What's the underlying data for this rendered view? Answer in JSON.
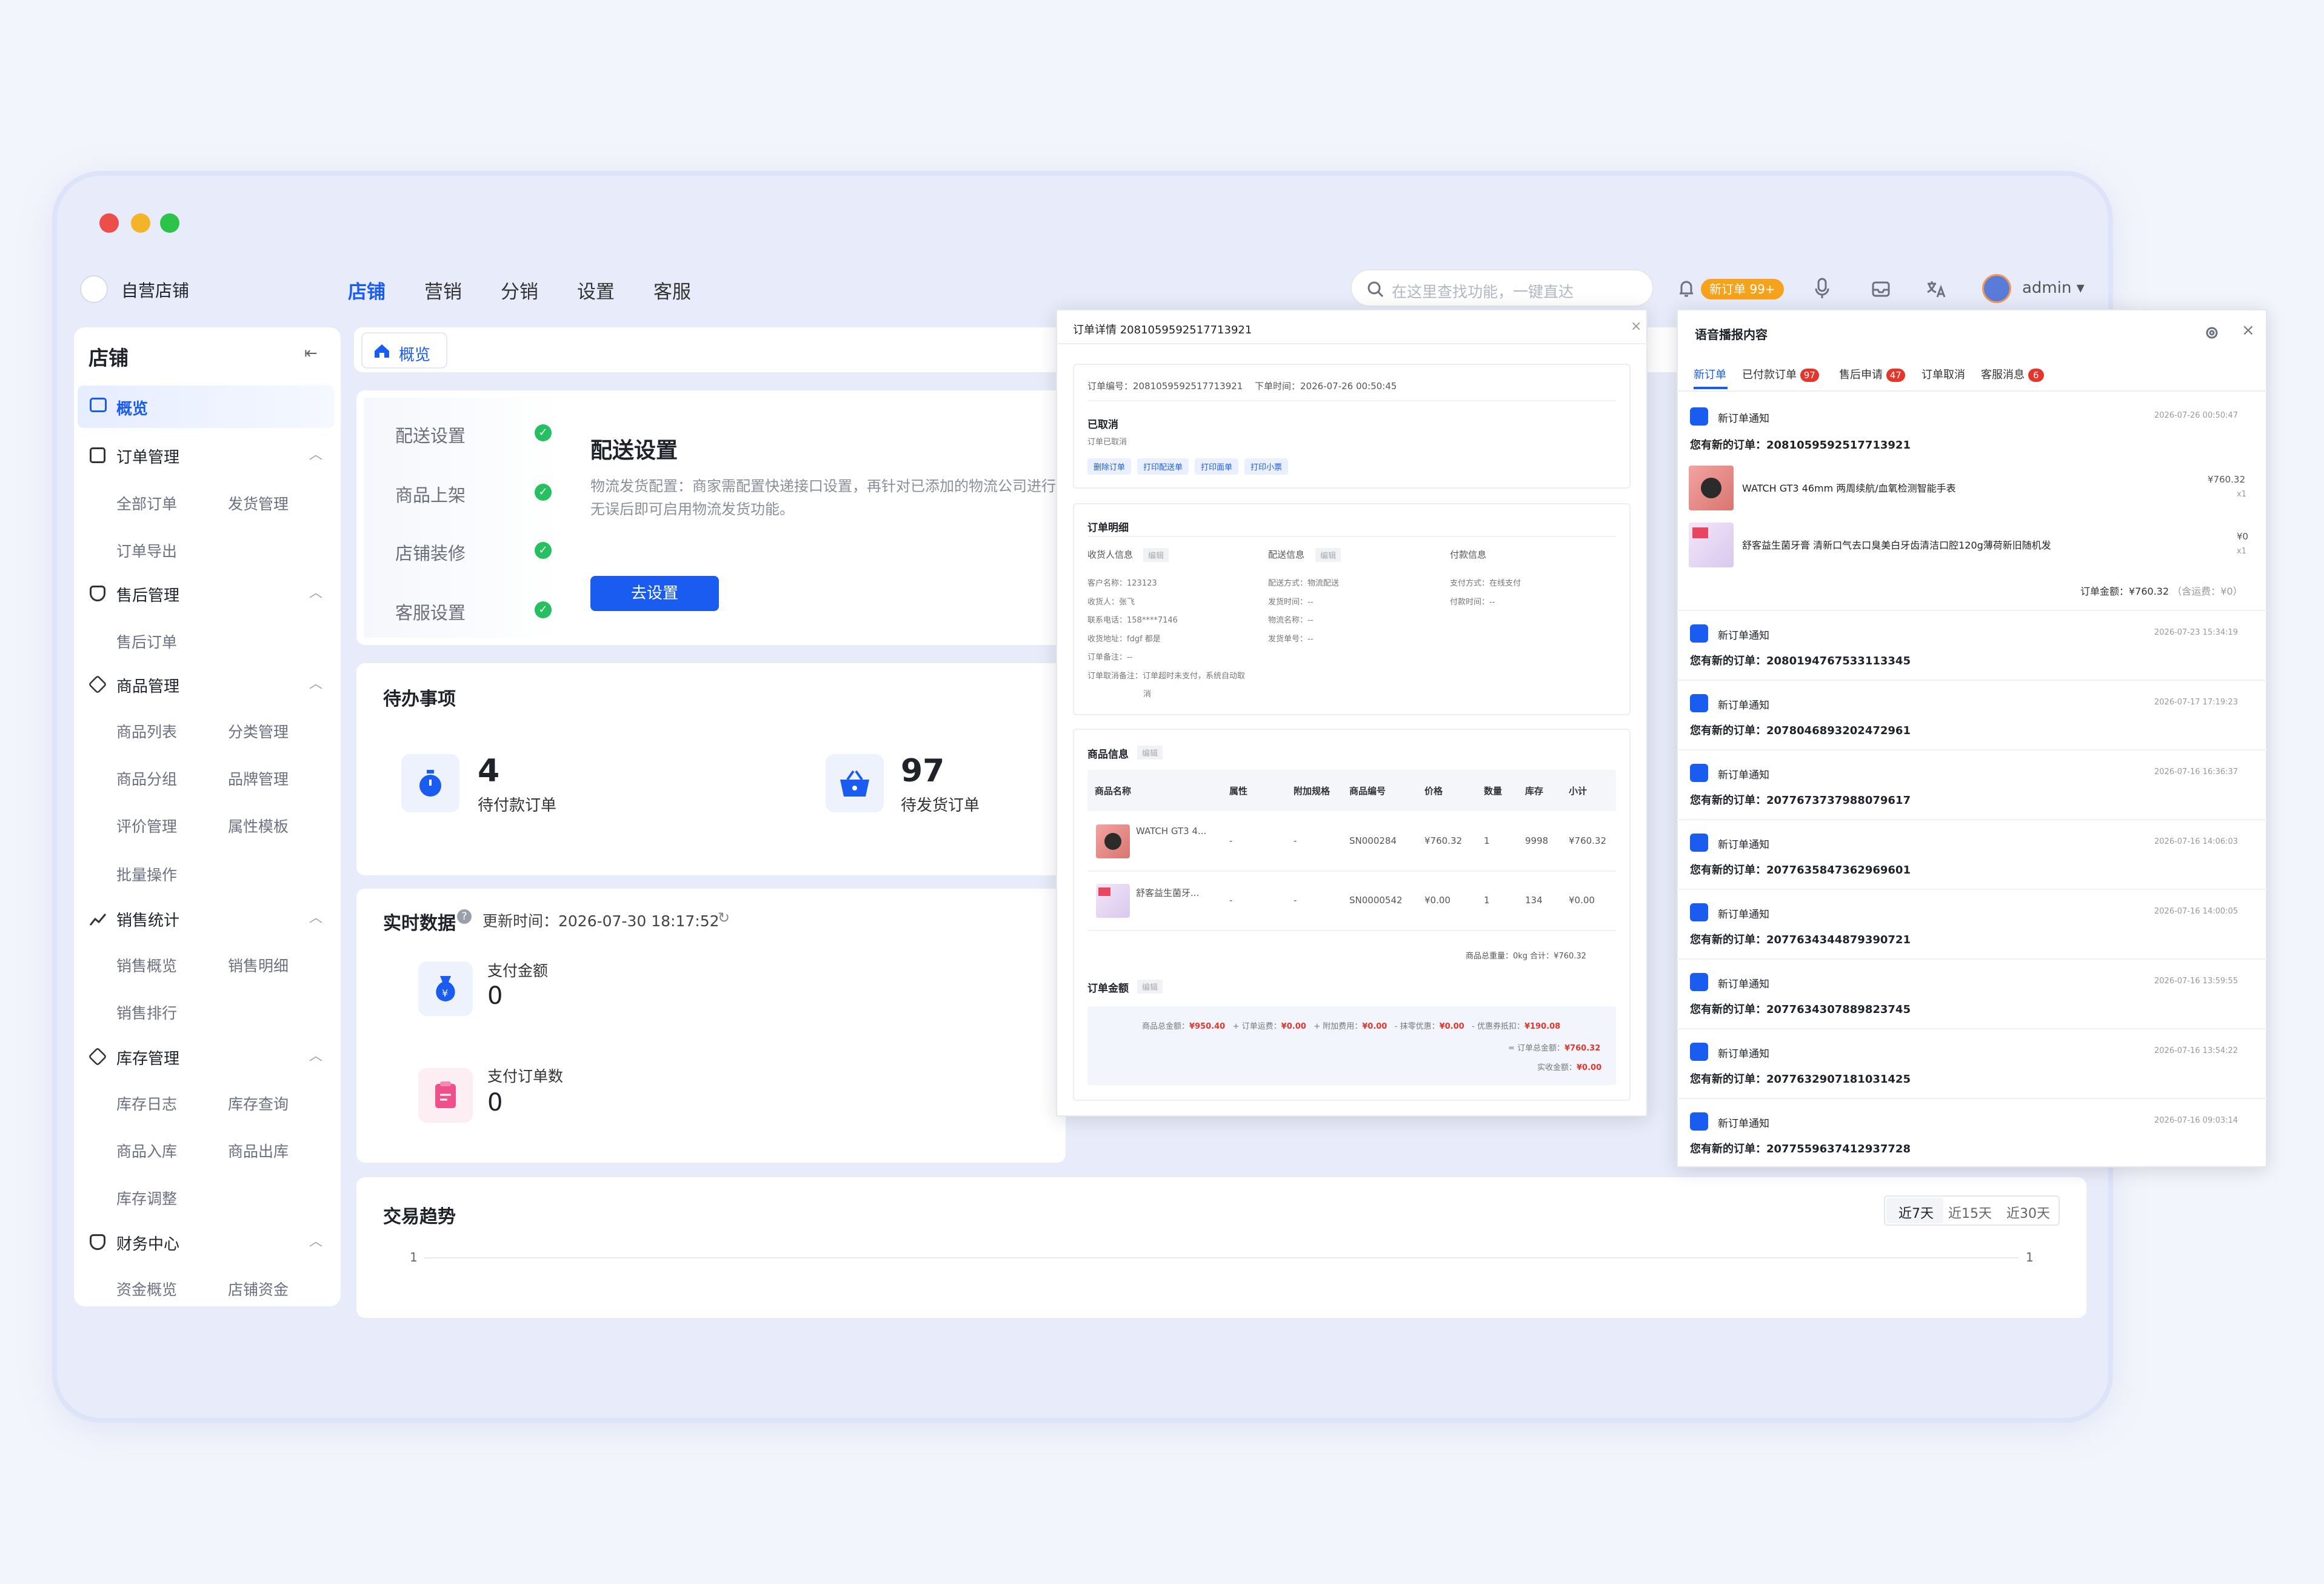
{
  "window": {
    "brand": "自营店铺",
    "nav": [
      "店铺",
      "营销",
      "分销",
      "设置",
      "客服"
    ],
    "search_placeholder": "在这里查找功能，一键直达",
    "new_order_badge": "新订单 99+",
    "user": "admin ▾"
  },
  "sidebar": {
    "title": "店铺",
    "overview": "概览",
    "groups": [
      {
        "label": "订单管理",
        "subs": [
          "全部订单",
          "发货管理",
          "订单导出"
        ]
      },
      {
        "label": "售后管理",
        "subs": [
          "售后订单"
        ]
      },
      {
        "label": "商品管理",
        "subs": [
          "商品列表",
          "分类管理",
          "商品分组",
          "品牌管理",
          "评价管理",
          "属性模板",
          "批量操作"
        ]
      },
      {
        "label": "销售统计",
        "subs": [
          "销售概览",
          "销售明细",
          "销售排行"
        ]
      },
      {
        "label": "库存管理",
        "subs": [
          "库存日志",
          "库存查询",
          "商品入库",
          "商品出库",
          "库存调整"
        ]
      },
      {
        "label": "财务中心",
        "subs": [
          "资金概览",
          "店铺资金"
        ]
      }
    ]
  },
  "tab": {
    "label": "概览"
  },
  "setup": {
    "steps": [
      "配送设置",
      "商品上架",
      "店铺装修",
      "客服设置"
    ],
    "title": "配送设置",
    "desc_line1": "物流发货配置：商家需配置快递接口设置，再针对已添加的物流公司进行",
    "desc_line2": "无误后即可启用物流发货功能。",
    "button": "去设置"
  },
  "todo": {
    "title": "待办事项",
    "items": [
      {
        "value": "4",
        "label": "待付款订单"
      },
      {
        "value": "97",
        "label": "待发货订单"
      }
    ]
  },
  "realtime": {
    "title": "实时数据",
    "update": "更新时间：2026-07-30 18:17:52",
    "items": [
      {
        "label": "支付金额",
        "value": "0"
      },
      {
        "label": "支付订单数",
        "value": "0"
      }
    ]
  },
  "trend": {
    "title": "交易趋势",
    "ranges": [
      "近7天",
      "近15天",
      "近30天"
    ],
    "y_left": "1",
    "y_right": "1"
  },
  "order_detail": {
    "title": "订单详情 20810595925177139­21",
    "order_no": "订单编号：20810595925177139­21",
    "order_time": "下单时间：2026-07-26 00:50:45",
    "status": "已取消",
    "status_sub": "订单已取消",
    "actions": [
      "删除订单",
      "打印配送单",
      "打印面单",
      "打印小票"
    ],
    "detail_title": "订单明细",
    "recv_title": "收货人信息",
    "ship_title": "配送信息",
    "pay_title": "付款信息",
    "edit": "编辑",
    "recv": [
      "客户名称：123123",
      "收货人：张飞",
      "联系电话：158****7146",
      "收货地址：fdgf 都是",
      "订单备注：--",
      "订单取消备注：订单超时未支付，系统自动取",
      "消"
    ],
    "ship": [
      "配送方式：物流配送",
      "发货时间：--",
      "物流名称：--",
      "发货单号：--"
    ],
    "pay": [
      "支付方式：在线支付",
      "付款时间：--"
    ],
    "goods_title": "商品信息",
    "goods_headers": [
      "商品名称",
      "属性",
      "附加规格",
      "商品编号",
      "价格",
      "数量",
      "库存",
      "小计"
    ],
    "goods": [
      {
        "name": "WATCH GT3 4...",
        "attr": "-",
        "extra": "-",
        "sn": "SN000284",
        "price": "¥760.32",
        "qty": "1",
        "stock": "9998",
        "sub": "¥760.32"
      },
      {
        "name": "舒客益生菌牙...",
        "attr": "-",
        "extra": "-",
        "sn": "SN0000542",
        "price": "¥0.00",
        "qty": "1",
        "stock": "134",
        "sub": "¥0.00"
      }
    ],
    "goods_total": "商品总重量：0kg  合计：¥760.32",
    "amount_title": "订单金额",
    "amount_line1": [
      "商品总金额：",
      "¥950.40",
      "+ 订单运费：",
      "¥0.00",
      "+ 附加费用：",
      "¥0.00",
      "- 抹零优惠：",
      "¥0.00",
      "- 优惠券抵扣：",
      "¥190.08"
    ],
    "amount_total_label": "= 订单总金额：",
    "amount_total": "¥760.32",
    "paid_label": "实收金额：",
    "paid": "¥0.00"
  },
  "voice": {
    "title": "语音播报内容",
    "tabs": [
      {
        "label": "新订单",
        "badge": ""
      },
      {
        "label": "已付款订单",
        "badge": "97"
      },
      {
        "label": "售后申请",
        "badge": "47"
      },
      {
        "label": "订单取消",
        "badge": ""
      },
      {
        "label": "客服消息",
        "badge": "6"
      }
    ],
    "first": {
      "title": "新订单通知",
      "time": "2026-07-26 00:50:47",
      "msg": "您有新的订单：20810595925177139­21",
      "items": [
        {
          "name": "WATCH GT3 46mm 两周续航/血氧检测智能手表",
          "price": "¥760.32",
          "qty": "x1"
        },
        {
          "name": "舒客益生菌牙膏 清新口气去口臭美白牙齿清洁口腔120g薄荷新旧随机发",
          "price": "¥0",
          "qty": "x1"
        }
      ],
      "total": "订单金额：¥760.32",
      "freight": "（含运费：¥0）"
    },
    "list": [
      {
        "title": "新订单通知",
        "time": "2026-07-23 15:34:19",
        "msg": "您有新的订单：20801947675331133­45"
      },
      {
        "title": "新订单通知",
        "time": "2026-07-17 17:19:23",
        "msg": "您有新的订单：20780468932024729­61"
      },
      {
        "title": "新订单通知",
        "time": "2026-07-16 16:36:37",
        "msg": "您有新的订单：20776737379880796­17"
      },
      {
        "title": "新订单通知",
        "time": "2026-07-16 14:06:03",
        "msg": "您有新的订单：20776358473629696­01"
      },
      {
        "title": "新订单通知",
        "time": "2026-07-16 14:00:05",
        "msg": "您有新的订单：20776343448793907­21"
      },
      {
        "title": "新订单通知",
        "time": "2026-07-16 13:59:55",
        "msg": "您有新的订单：20776343078898237­45"
      },
      {
        "title": "新订单通知",
        "time": "2026-07-16 13:54:22",
        "msg": "您有新的订单：20776329071810314­25"
      },
      {
        "title": "新订单通知",
        "time": "2026-07-16 09:03:14",
        "msg": "您有新的订单：20775596374129377­28"
      }
    ]
  }
}
